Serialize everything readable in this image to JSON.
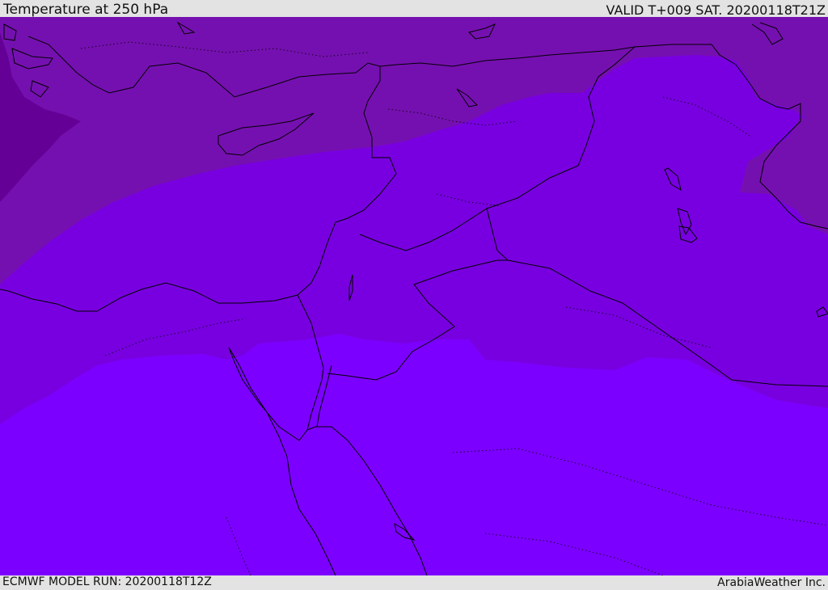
{
  "header": {
    "title": "Temperature at 250 hPa",
    "valid": "VALID T+009 SAT. 20200118T21Z"
  },
  "footer": {
    "model_run": "ECMWF MODEL RUN: 20200118T12Z",
    "credit": "ArabiaWeather Inc."
  },
  "colors": {
    "band_darkest": "#650096",
    "band_dark": "#7510b0",
    "band_mid": "#7800e0",
    "band_light": "#7c00ff",
    "coastline": "#000000",
    "bar_background": "#e3e3e3"
  }
}
